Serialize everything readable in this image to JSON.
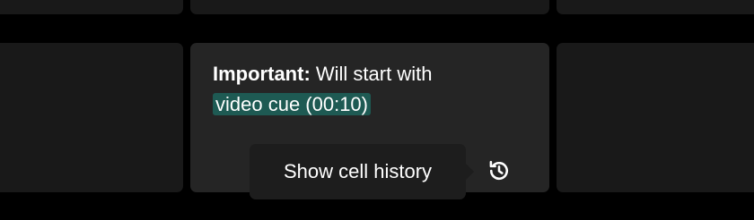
{
  "cell_note": {
    "label": "Important:",
    "text": "Will start with",
    "cue": "video cue (00:10)"
  },
  "tooltip": {
    "label": "Show cell history"
  },
  "icons": {
    "history": "history-icon"
  },
  "colors": {
    "background": "#000000",
    "cell": "#191919",
    "cell_active": "#252525",
    "cue_highlight": "#1e5a53",
    "tooltip_bg": "#1d1d1d"
  }
}
